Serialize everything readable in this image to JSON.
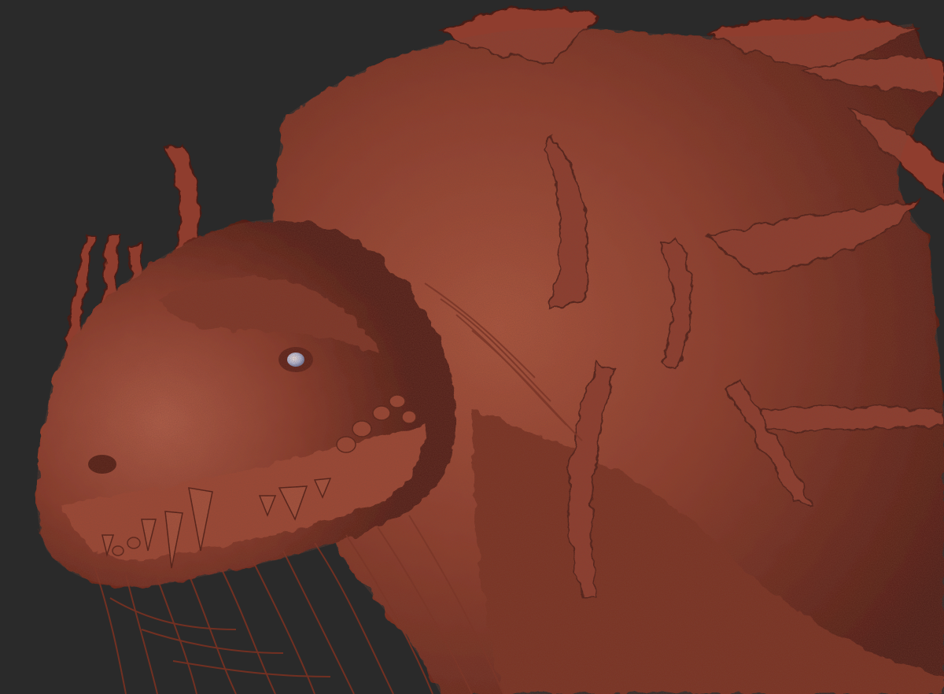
{
  "scene": {
    "background_color": "#2a2a2a",
    "subject": "dragon-head-sculpt",
    "material_color": "#8e3d2c",
    "material_shadow_color": "#4a1a12",
    "material_highlight_color": "#b5604a",
    "eye_color": "#dfe9ff"
  }
}
